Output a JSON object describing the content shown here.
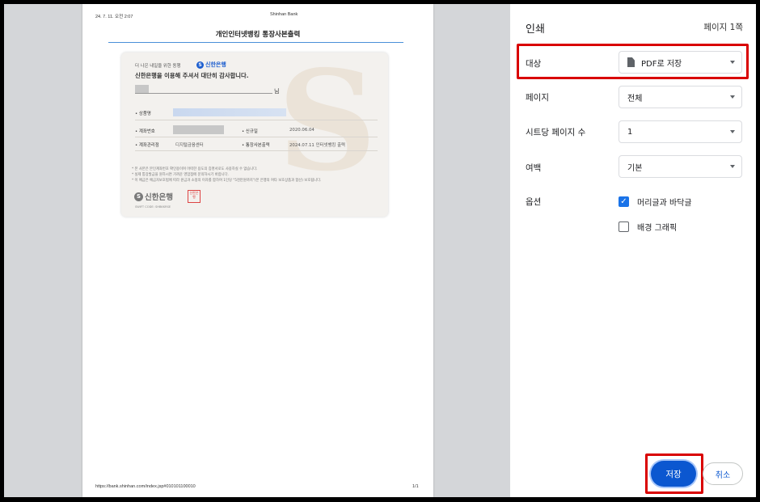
{
  "preview": {
    "header_left": "24. 7. 11. 오전 2:07",
    "header_center": "Shinhan Bank",
    "title": "개인인터넷뱅킹 통장사본출력",
    "footer_left": "https://bank.shinhan.com/index.jsp#010101100010",
    "footer_right": "1/1",
    "card": {
      "greeting": "더 나은 내일을 위한 동행",
      "bank_name": "신한은행",
      "thanks": "신한은행을 이용해 주셔서 대단히 감사합니다.",
      "name_suffix": "님",
      "product_label": "상품명",
      "account_label": "계좌번호",
      "opened_label": "신규일",
      "opened_value": "2020.06.04",
      "manager_label": "계좌관리점",
      "manager_value": "디지털금융센터",
      "print_label": "통장사본출력",
      "print_value": "2024.07.11 인터넷뱅킹 출력",
      "notes": [
        "* 본 사본은 본인계좌번호 확인용이며 어떠한 용도의 증명서로도 사용하실 수 없습니다.",
        "* 실제 통장발급을 원하시면 가까운 영업점에 문의하시기 바랍니다.",
        "* 이 예금은 예금자보호법에 따라 원금과 소정의 이자를 합하여 1인당 \"5천만원까지\"(본 은행의 여타 보호상품과 합산) 보호됩니다."
      ],
      "logo_text": "신한은행",
      "seal_text": "신한은행",
      "swift": "SWIFT CODE: SHBKKRSE"
    }
  },
  "sidebar": {
    "title": "인쇄",
    "page_count": "페이지 1쪽",
    "destination_label": "대상",
    "destination_value": "PDF로 저장",
    "pages_label": "페이지",
    "pages_value": "전체",
    "pages_per_sheet_label": "시트당 페이지 수",
    "pages_per_sheet_value": "1",
    "margins_label": "여백",
    "margins_value": "기본",
    "options_label": "옵션",
    "option_headers": "머리글과 바닥글",
    "option_headers_checked": true,
    "option_background": "배경 그래픽",
    "option_background_checked": false,
    "save_button": "저장",
    "cancel_button": "취소"
  },
  "colors": {
    "accent": "#0b57d0",
    "highlight": "#d90000"
  },
  "icons": [
    "document-icon",
    "chevron-down-icon",
    "checkmark-icon",
    "shinhan-logo-icon"
  ]
}
